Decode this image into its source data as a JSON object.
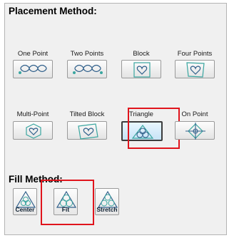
{
  "placement": {
    "title": "Placement Method:",
    "options": [
      {
        "label": "One Point",
        "icon": "one-point-icon"
      },
      {
        "label": "Two Points",
        "icon": "two-points-icon"
      },
      {
        "label": "Block",
        "icon": "block-icon"
      },
      {
        "label": "Four Points",
        "icon": "four-points-icon"
      },
      {
        "label": "Multi-Point",
        "icon": "multi-point-icon"
      },
      {
        "label": "Tilted Block",
        "icon": "tilted-block-icon"
      },
      {
        "label": "Triangle",
        "icon": "triangle-icon",
        "selected": true
      },
      {
        "label": "On Point",
        "icon": "on-point-icon"
      }
    ]
  },
  "fill": {
    "title": "Fill Method:",
    "options": [
      {
        "label": "Center",
        "icon": "fill-center-icon"
      },
      {
        "label": "Fit",
        "icon": "fill-fit-icon",
        "selected": true
      },
      {
        "label": "Stretch",
        "icon": "fill-stretch-icon"
      }
    ]
  },
  "colors": {
    "accent_highlight": "#e0141c",
    "icon_stroke": "#2f5f8a",
    "icon_teal": "#3aa6a0"
  }
}
